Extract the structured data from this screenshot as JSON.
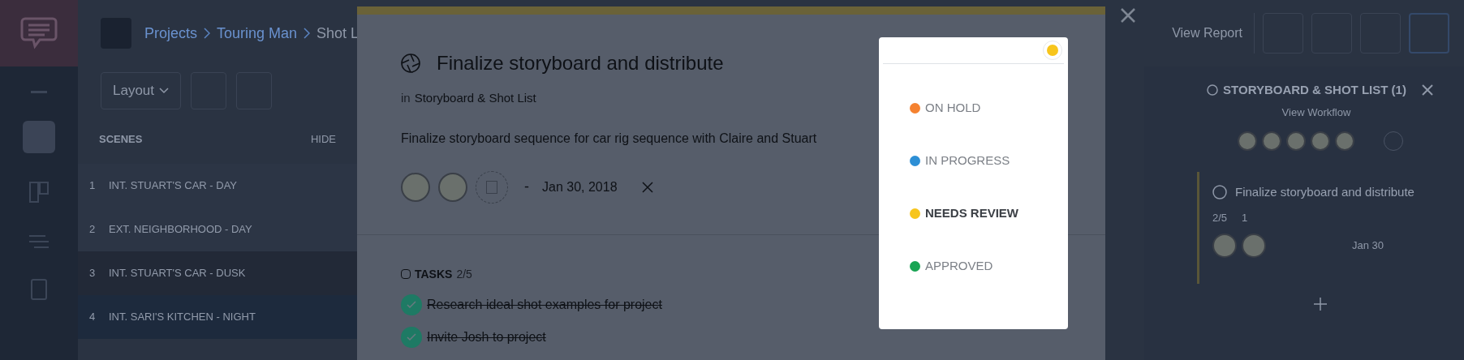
{
  "header": {
    "breadcrumb": [
      "Projects",
      "Touring Man",
      "Shot L"
    ],
    "report_button": "View Report"
  },
  "toolbar": {
    "layout_button": "Layout"
  },
  "scenes": {
    "title": "SCENES",
    "hide": "HIDE",
    "rows": [
      {
        "number": "1",
        "name": "INT. STUART'S CAR - DAY",
        "color": "#2c3545"
      },
      {
        "number": "2",
        "name": "EXT. NEIGHBORHOOD - DAY",
        "color": "#2c3545"
      },
      {
        "number": "3",
        "name": "INT. STUART'S CAR - DUSK",
        "color": "#222937"
      },
      {
        "number": "4",
        "name": "INT. SARI'S KITCHEN - NIGHT",
        "color": "#1d2a3d"
      }
    ]
  },
  "task_modal": {
    "title": "Finalize storyboard and distribute",
    "list_prefix": "in",
    "list_name": "Storyboard & Shot List",
    "description": "Finalize storyboard sequence for car rig sequence with Claire and Stuart",
    "date_separator": "-",
    "due_date": "Jan 30, 2018",
    "tasks_label": "TASKS",
    "tasks_count": "2/5",
    "tasks": [
      {
        "text": "Research ideal shot examples for project",
        "done": true
      },
      {
        "text": "Invite Josh to project",
        "done": true
      }
    ]
  },
  "status_menu": {
    "options": [
      {
        "label": "ON HOLD",
        "color": "#f58230",
        "selected": false
      },
      {
        "label": "IN PROGRESS",
        "color": "#2d8fd5",
        "selected": false
      },
      {
        "label": "NEEDS REVIEW",
        "color": "#f7c51c",
        "selected": true
      },
      {
        "label": "APPROVED",
        "color": "#18a453",
        "selected": false
      }
    ]
  },
  "side_panel": {
    "title": "STORYBOARD & SHOT LIST (1)",
    "link": "View Workflow",
    "card": {
      "title": "Finalize storyboard and distribute",
      "tasks": "2/5",
      "attachments": "1",
      "due": "Jan 30"
    }
  }
}
